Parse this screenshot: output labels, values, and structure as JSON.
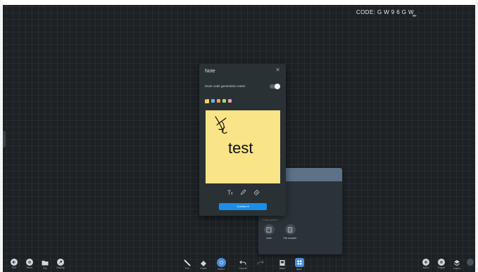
{
  "code": {
    "text": "CODE: G W 9 6 G W"
  },
  "note": {
    "title": "Note",
    "scan_label": "Scan code generation notes",
    "sticky_text": "test",
    "confirm_label": "Confirm it",
    "swatch_colors": [
      "#f5d35a",
      "#64b5f6",
      "#ff9f45",
      "#a6dd70",
      "#ef9ab0"
    ]
  },
  "panel": {
    "section_label": "Cross-system",
    "tools": [
      {
        "label": "Note",
        "icon": "note-icon"
      },
      {
        "label": "File transfer",
        "icon": "file-transfer-icon"
      }
    ]
  },
  "toolbar": {
    "left": [
      {
        "label": "Exit",
        "icon": "exit-icon"
      },
      {
        "label": "Menu",
        "icon": "settings-icon"
      },
      {
        "label": "File",
        "icon": "folder-icon"
      },
      {
        "label": "Display",
        "icon": "display-icon"
      }
    ],
    "center": [
      {
        "label": "Pen",
        "icon": "pen-icon"
      },
      {
        "label": "Erase",
        "icon": "eraser-icon"
      },
      {
        "label": "Select",
        "icon": "select-icon"
      },
      {
        "label": "Cancel",
        "icon": "undo-icon"
      },
      {
        "label": "",
        "icon": "redo-icon"
      },
      {
        "label": "Write",
        "icon": "write-icon"
      },
      {
        "label": "Apps",
        "icon": "apps-icon"
      }
    ],
    "right": [
      {
        "label": "Add p",
        "icon": "add-page-icon"
      },
      {
        "label": "Pages",
        "icon": "pages-icon"
      },
      {
        "label": "Layers",
        "icon": "layers-icon"
      },
      {
        "label": "",
        "icon": "more-icon"
      }
    ]
  },
  "colors": {
    "accent": "#1a8ee8",
    "note_yellow": "#f9e487",
    "canvas": "#1d2124"
  }
}
